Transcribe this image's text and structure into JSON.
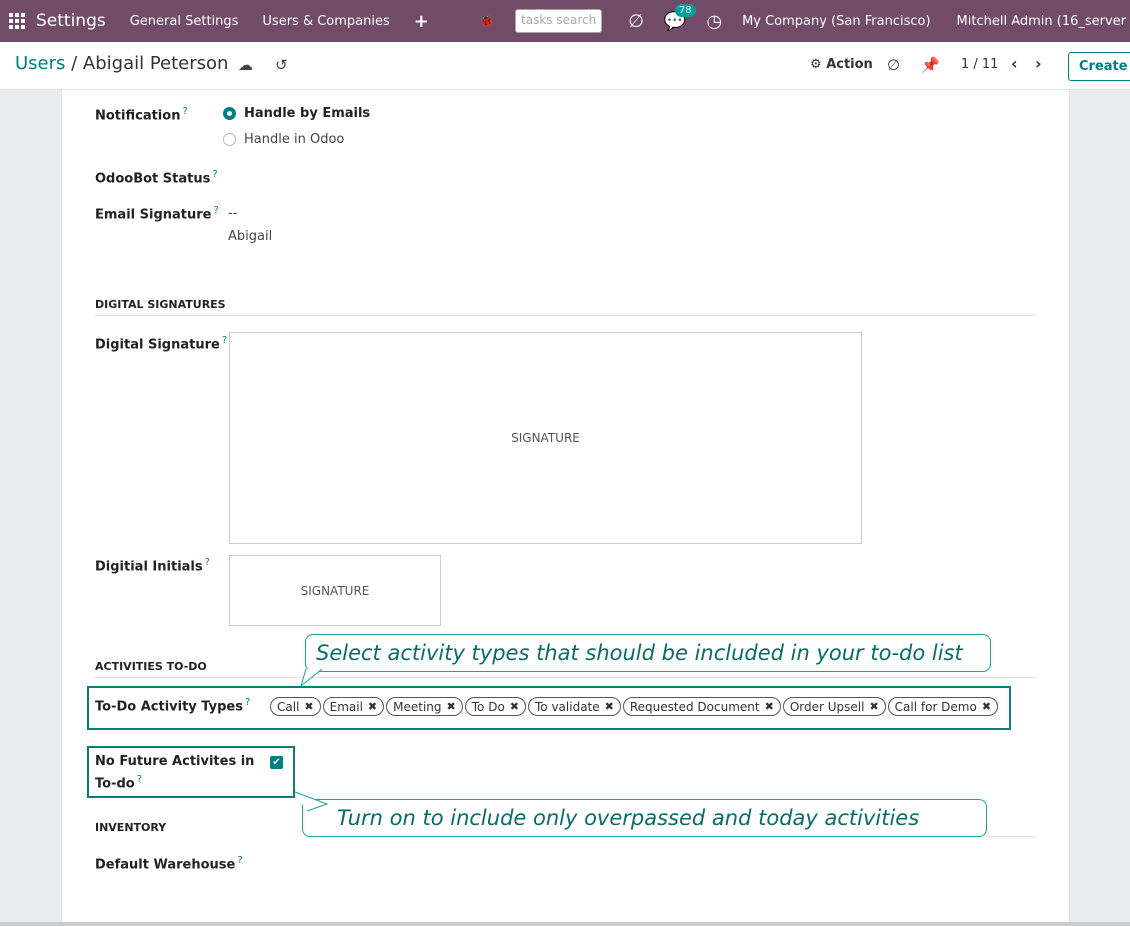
{
  "navbar": {
    "brand": "Settings",
    "menu": [
      "General Settings",
      "Users & Companies"
    ],
    "search_placeholder": "tasks search",
    "messages_count": "78",
    "company": "My Company (San Francisco)",
    "user": "Mitchell Admin (16_server"
  },
  "control_panel": {
    "breadcrumb_parent": "Users",
    "breadcrumb_sep": " / ",
    "breadcrumb_current": "Abigail Peterson",
    "action_label": "Action",
    "pager": "1 / 11",
    "create_label": "Create"
  },
  "form": {
    "notification_label": "Notification",
    "notification_options": [
      "Handle by Emails",
      "Handle in Odoo"
    ],
    "notification_selected": "Handle by Emails",
    "odoobot_label": "OdooBot Status",
    "email_signature_label": "Email Signature",
    "email_signature_value": [
      "--",
      "Abigail"
    ],
    "digital_signatures_section": "DIGITAL SIGNATURES",
    "digital_signature_label": "Digital Signature",
    "digital_initials_label": "Digitial Initials",
    "signature_placeholder": "SIGNATURE",
    "activities_section": "ACTIVITIES TO-DO",
    "todo_activity_label": "To-Do Activity Types",
    "todo_activity_tags": [
      "Call",
      "Email",
      "Meeting",
      "To Do",
      "To validate",
      "Requested Document",
      "Order Upsell",
      "Call for Demo"
    ],
    "no_future_label_line1": "No Future Activites in",
    "no_future_label_line2": "To-do",
    "no_future_checked": true,
    "inventory_section": "INVENTORY",
    "default_warehouse_label": "Default Warehouse",
    "help_mark": "?"
  },
  "callouts": {
    "activity_types": "Select activity types that should be included in your to-do list",
    "no_future": "Turn on to include only overpassed and today activities"
  }
}
